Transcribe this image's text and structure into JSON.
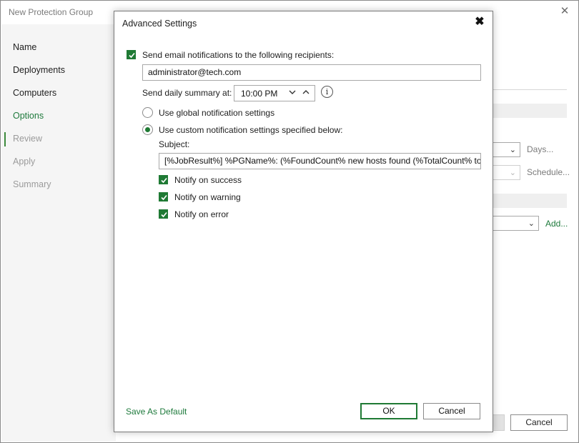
{
  "wizard": {
    "title": "New Protection Group",
    "close_glyph": "✕",
    "steps": [
      {
        "label": "Name",
        "state": "normal"
      },
      {
        "label": "Deployments",
        "state": "normal"
      },
      {
        "label": "Computers",
        "state": "normal"
      },
      {
        "label": "Options",
        "state": "active"
      },
      {
        "label": "Review",
        "state": "disabled"
      },
      {
        "label": "Apply",
        "state": "disabled"
      },
      {
        "label": "Summary",
        "state": "disabled"
      }
    ],
    "days_link": "Days...",
    "schedule_link": "Schedule...",
    "add_link": "Add...",
    "cancel_label": "Cancel"
  },
  "dialog": {
    "title": "Advanced Settings",
    "send_email_label": "Send email notifications to the following recipients:",
    "send_email_checked": true,
    "recipients_value": "administrator@tech.com",
    "daily_summary_label": "Send daily summary at:",
    "daily_summary_time": "10:00 PM",
    "use_global_label": "Use global notification settings",
    "use_custom_label": "Use custom notification settings specified below:",
    "selected_mode": "custom",
    "subject_label": "Subject:",
    "subject_value": "[%JobResult%] %PGName%: (%FoundCount% new hosts found (%TotalCount% tot",
    "notify_success_label": "Notify on success",
    "notify_warning_label": "Notify on warning",
    "notify_error_label": "Notify on error",
    "notify_success": true,
    "notify_warning": true,
    "notify_error": true,
    "save_default_label": "Save As Default",
    "ok_label": "OK",
    "cancel_label": "Cancel"
  },
  "colors": {
    "accent_green": "#1f7a34",
    "link_green": "#1e7a3c",
    "disabled_text": "#9b9b9b"
  }
}
